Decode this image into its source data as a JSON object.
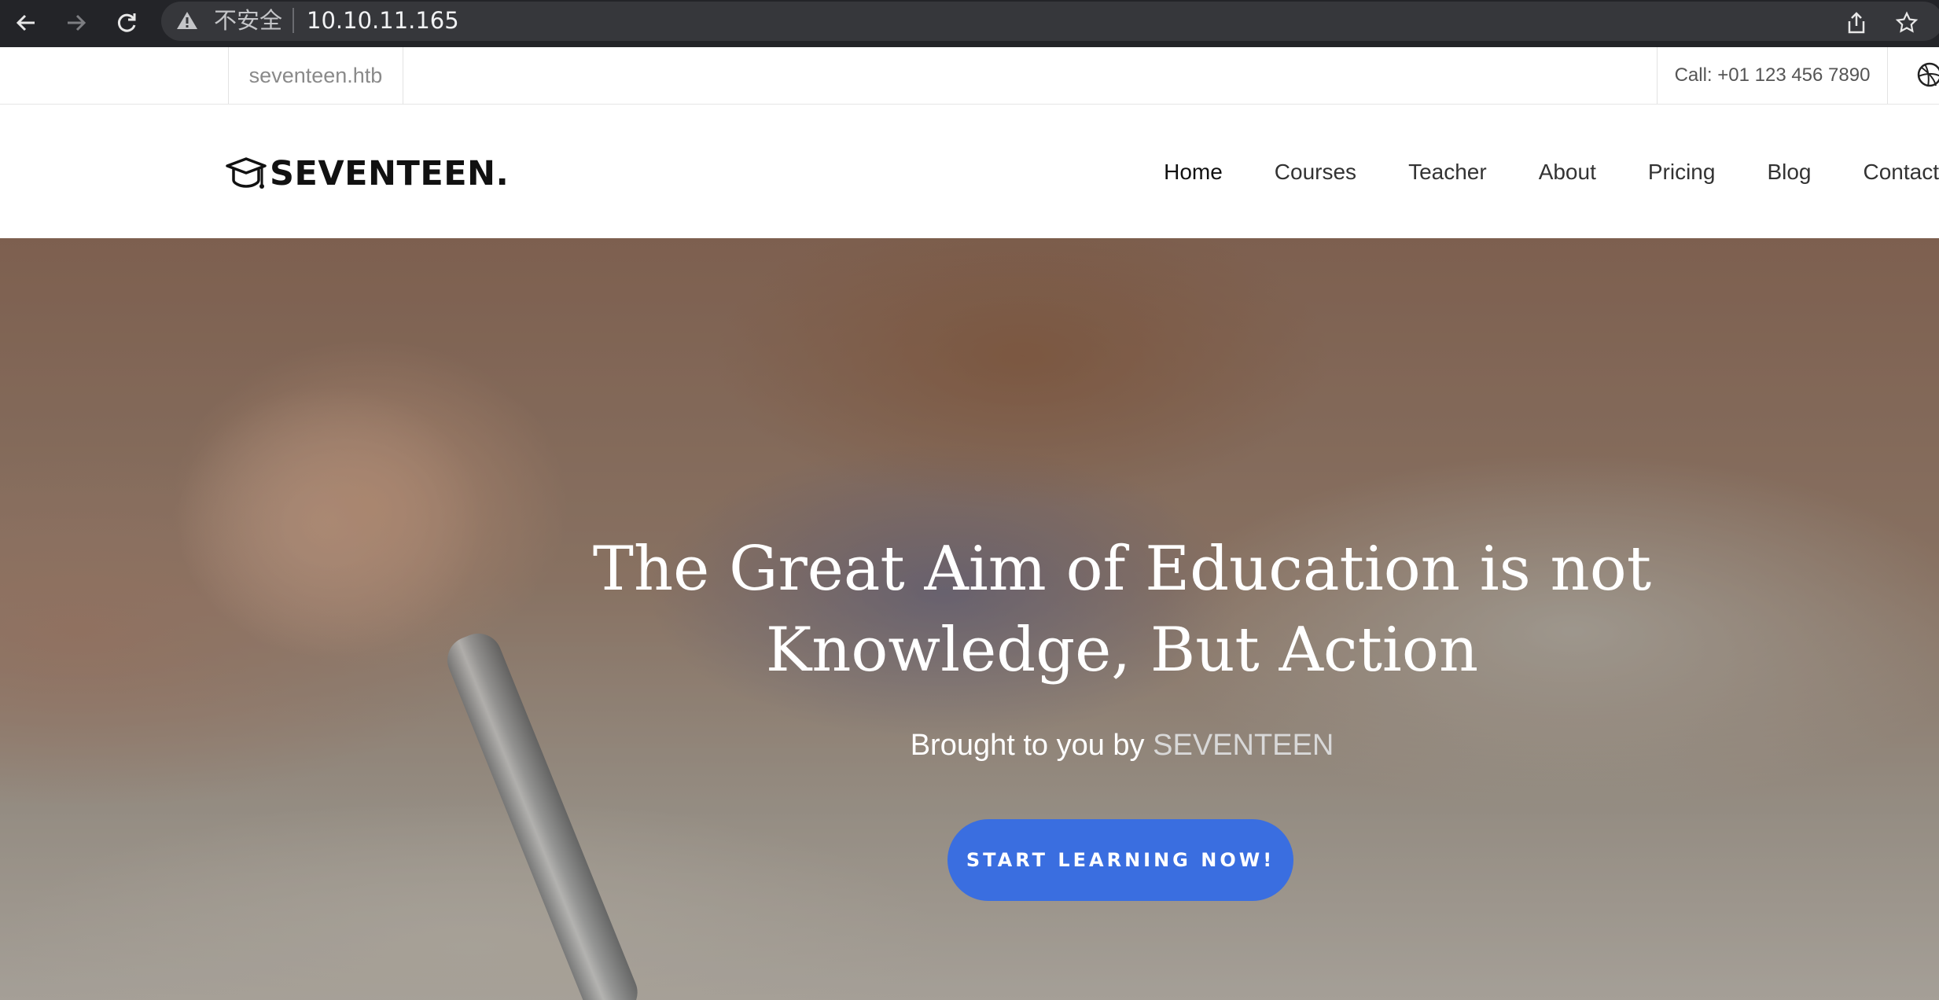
{
  "browser": {
    "security_label": "不安全",
    "url": "10.10.11.165"
  },
  "topbar": {
    "domain": "seventeen.htb",
    "call": "Call: +01 123 456 7890"
  },
  "nav": {
    "logo_text": "SEVENTEEN.",
    "items": [
      {
        "label": "Home"
      },
      {
        "label": "Courses"
      },
      {
        "label": "Teacher"
      },
      {
        "label": "About"
      },
      {
        "label": "Pricing"
      },
      {
        "label": "Blog"
      },
      {
        "label": "Contact"
      }
    ]
  },
  "hero": {
    "title_line1": "The Great Aim of Education is not",
    "title_line2": "Knowledge, But Action",
    "subtitle_prefix": "Brought to you by",
    "subtitle_brand": "SEVENTEEN",
    "cta_label": "START LEARNING NOW!"
  },
  "colors": {
    "accent": "#3a6ee0",
    "chrome_bg": "#232428"
  }
}
